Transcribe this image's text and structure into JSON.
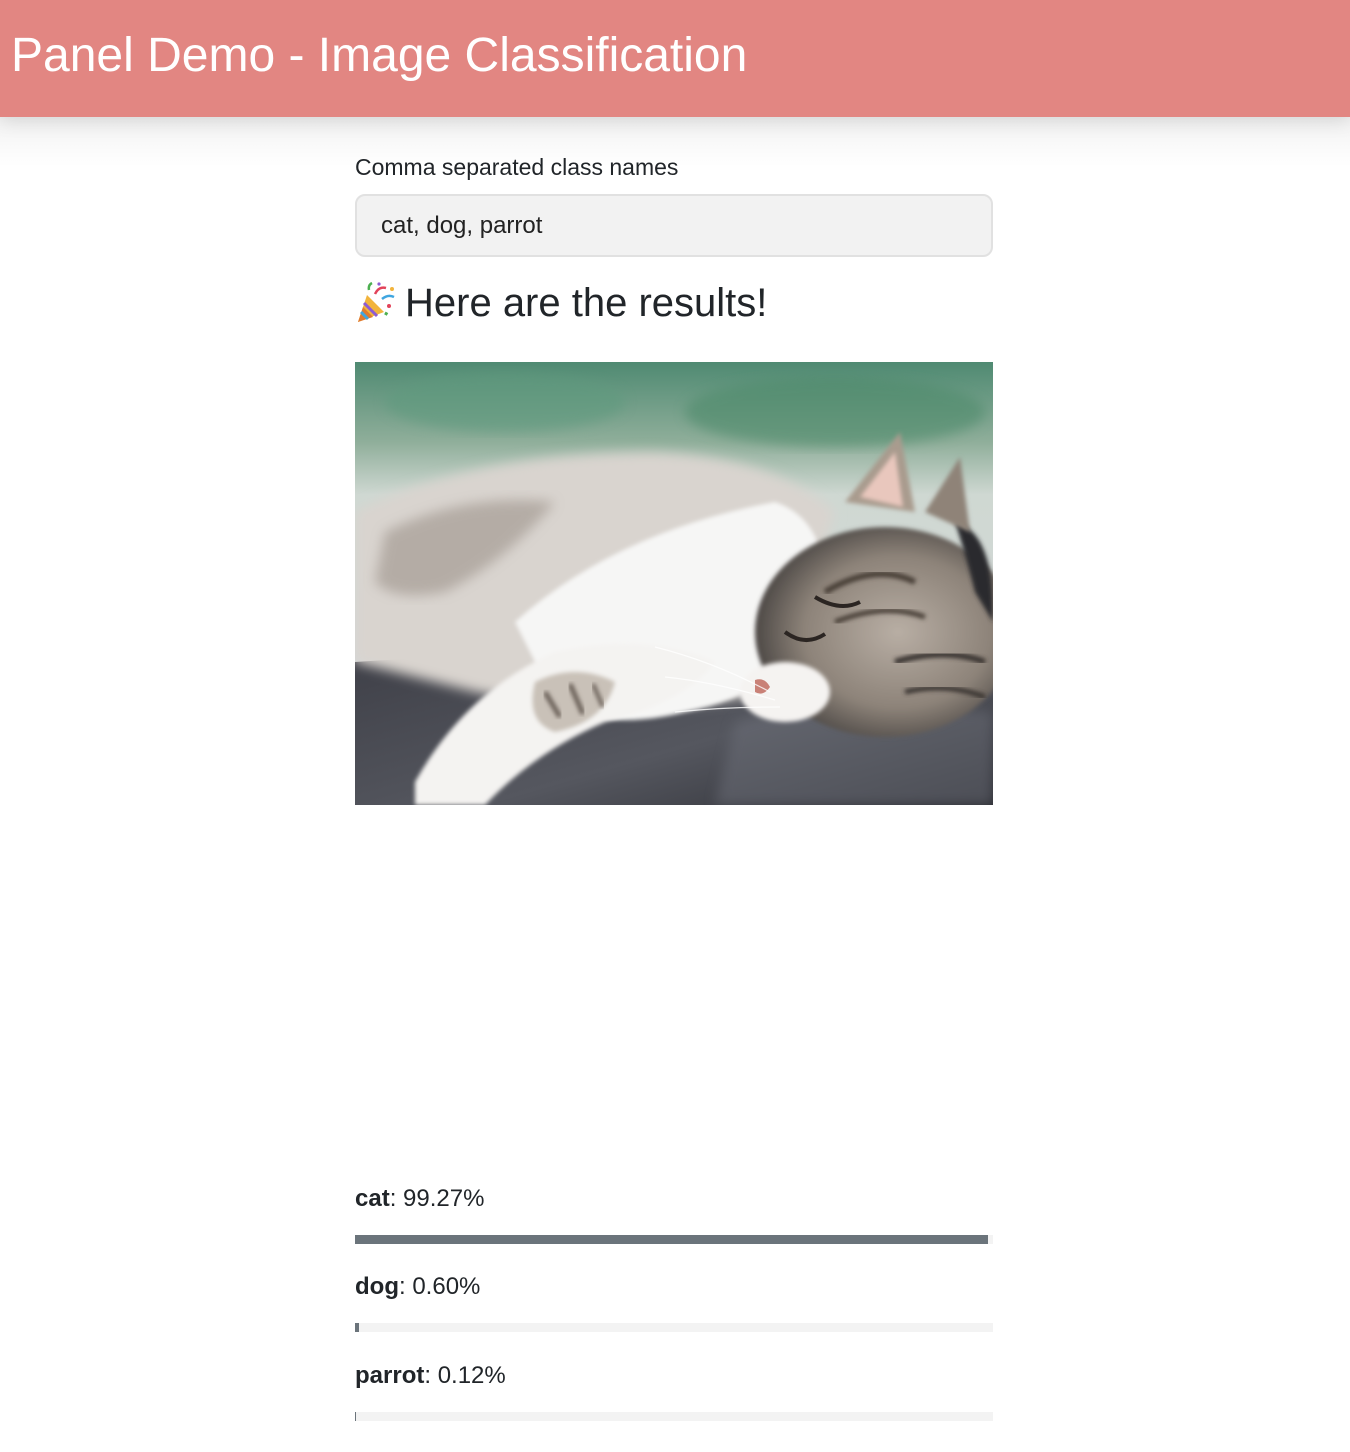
{
  "header": {
    "title": "Panel Demo - Image Classification"
  },
  "form": {
    "label": "Comma separated class names",
    "value": "cat, dog, parrot"
  },
  "results": {
    "icon": "party-popper-icon",
    "heading": "Here are the results!"
  },
  "image": {
    "subject": "sleeping cat photo"
  },
  "classifications": [
    {
      "name": "cat",
      "score_text": "99.27%",
      "fraction": 0.9927
    },
    {
      "name": "dog",
      "score_text": "0.60%",
      "fraction": 0.006
    },
    {
      "name": "parrot",
      "score_text": "0.12%",
      "fraction": 0.0012
    }
  ],
  "colors": {
    "header_bg": "#e28682",
    "bar_fill": "#6b747b",
    "bar_track": "#f3f3f3",
    "input_bg": "#f2f2f2"
  }
}
